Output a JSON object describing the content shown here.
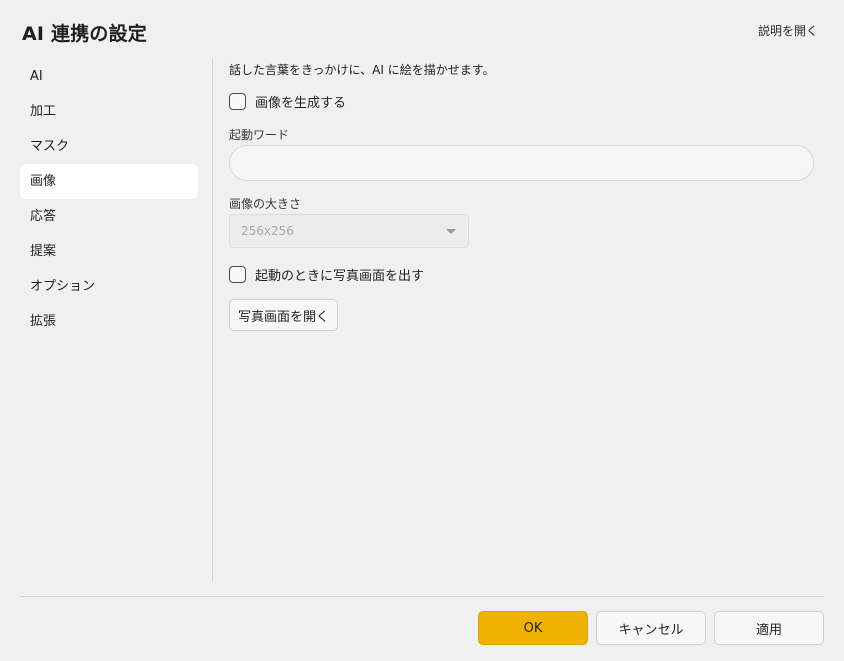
{
  "dialog": {
    "title": "AI 連携の設定",
    "help_link": "説明を開く"
  },
  "sidebar": {
    "items": [
      {
        "label": "AI",
        "active": false
      },
      {
        "label": "加工",
        "active": false
      },
      {
        "label": "マスク",
        "active": false
      },
      {
        "label": "画像",
        "active": true
      },
      {
        "label": "応答",
        "active": false
      },
      {
        "label": "提案",
        "active": false
      },
      {
        "label": "オプション",
        "active": false
      },
      {
        "label": "拡張",
        "active": false
      }
    ]
  },
  "main": {
    "description": "話した言葉をきっかけに、AI に絵を描かせます。",
    "generate_checkbox": {
      "label": "画像を生成する",
      "checked": false
    },
    "trigger_word": {
      "label": "起動ワード",
      "value": "",
      "placeholder": ""
    },
    "image_size": {
      "label": "画像の大きさ",
      "value": "256x256",
      "disabled": true
    },
    "photo_on_start_checkbox": {
      "label": "起動のときに写真画面を出す",
      "checked": false
    },
    "open_photo_button": "写真画面を開く"
  },
  "footer": {
    "ok": "OK",
    "cancel": "キャンセル",
    "apply": "適用"
  },
  "colors": {
    "accent": "#f0b100",
    "background": "#f0f0f0",
    "active_nav": "#ffffff"
  }
}
